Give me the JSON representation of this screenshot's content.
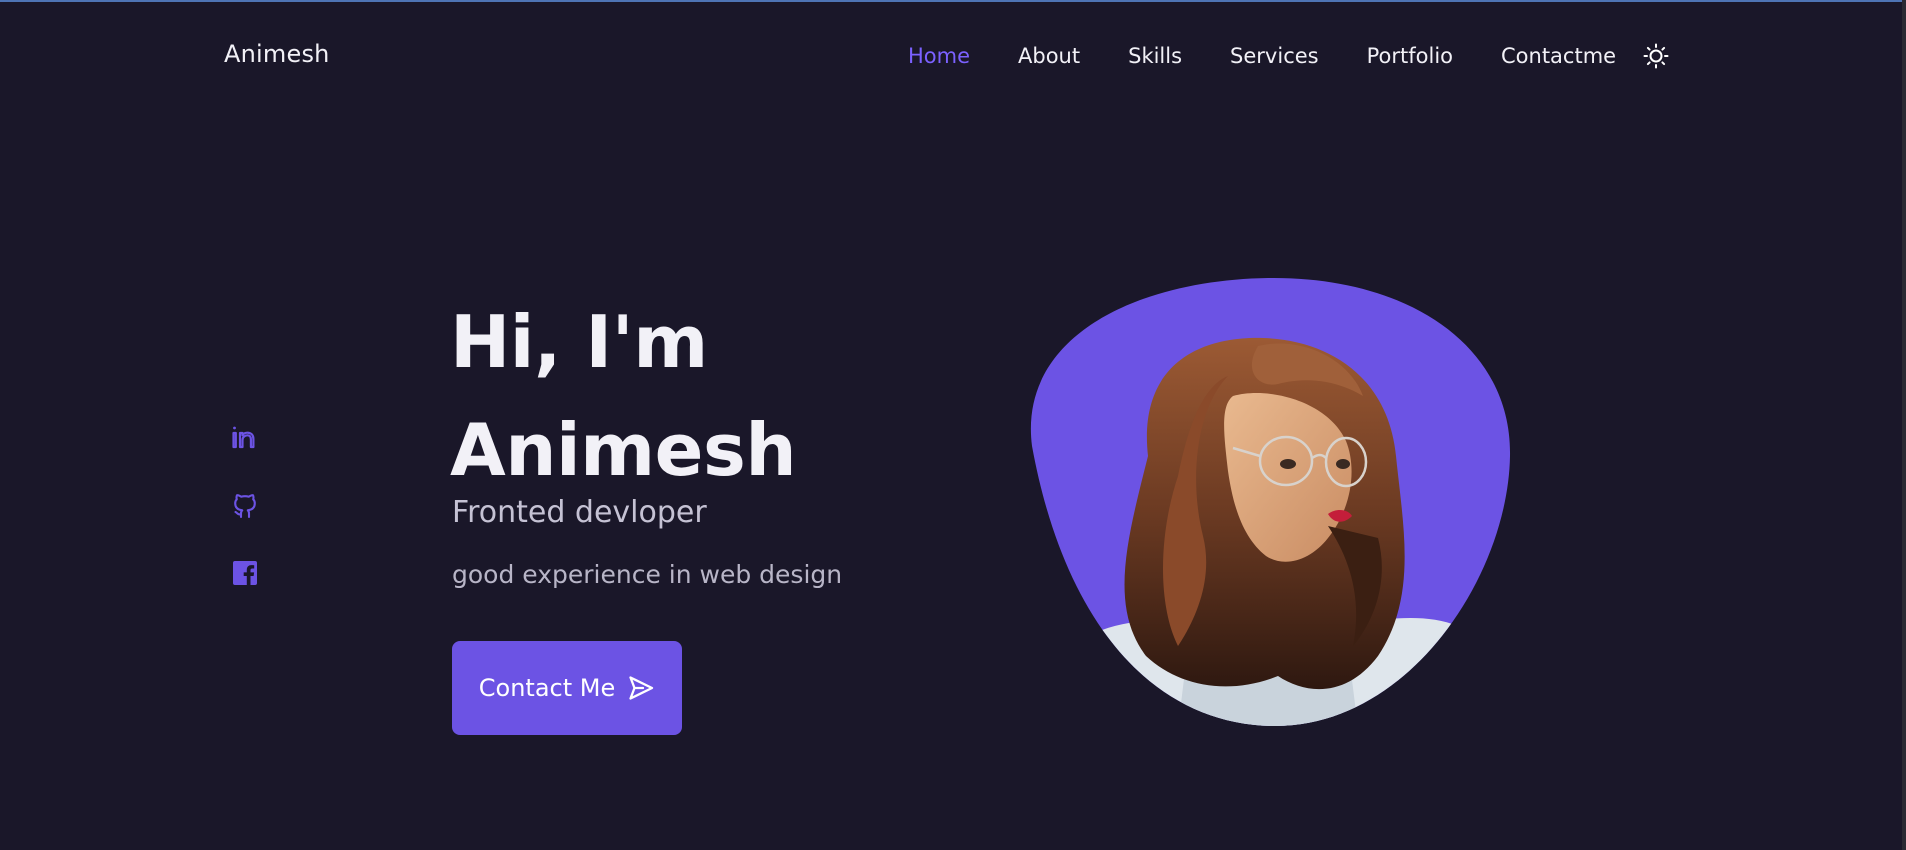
{
  "header": {
    "logo": "Animesh",
    "nav": [
      {
        "label": "Home",
        "active": true
      },
      {
        "label": "About"
      },
      {
        "label": "Skills"
      },
      {
        "label": "Services"
      },
      {
        "label": "Portfolio"
      },
      {
        "label": "Contactme"
      }
    ],
    "theme_icon": "sun-icon"
  },
  "socials": [
    {
      "icon": "linkedin-icon"
    },
    {
      "icon": "github-icon"
    },
    {
      "icon": "facebook-icon"
    }
  ],
  "hero": {
    "title_line1": "Hi, I'm",
    "title_line2": "Animesh",
    "subtitle": "Fronted devloper",
    "description": "good experience in web design",
    "button_label": "Contact Me",
    "button_icon": "send-icon",
    "image": "profile-photo"
  },
  "colors": {
    "background": "#1a1729",
    "accent": "#6c53e4",
    "nav_active": "#7b61ff",
    "text": "#f2f1f7"
  }
}
